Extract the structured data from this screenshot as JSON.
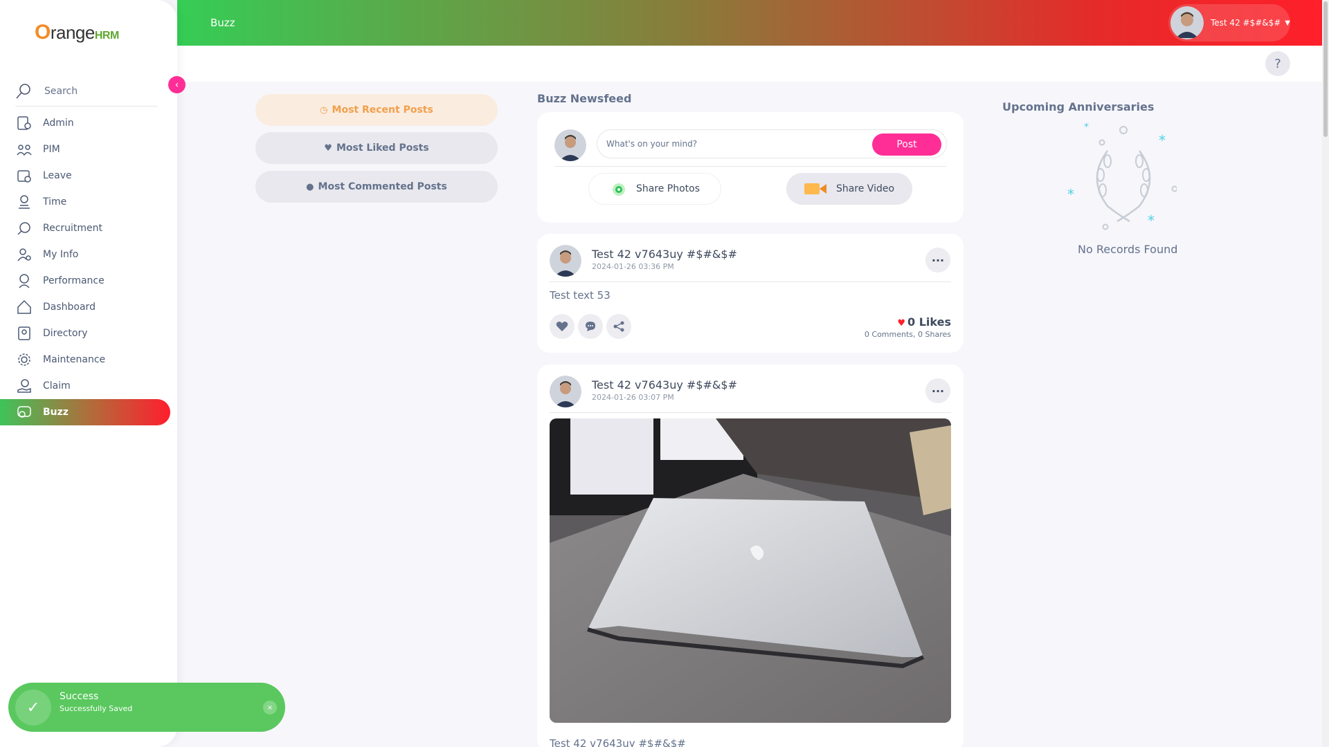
{
  "brand": {
    "part1": "O",
    "part2": "range",
    "part3": "HRM"
  },
  "topbar": {
    "title": "Buzz",
    "user_name": "Test 42 #$#&$#",
    "help": "?"
  },
  "sidebar": {
    "search_label": "Search",
    "collapse_icon": "‹",
    "items": [
      {
        "label": "Admin",
        "icon": "admin-icon"
      },
      {
        "label": "PIM",
        "icon": "pim-icon"
      },
      {
        "label": "Leave",
        "icon": "leave-icon"
      },
      {
        "label": "Time",
        "icon": "time-icon"
      },
      {
        "label": "Recruitment",
        "icon": "recruitment-icon"
      },
      {
        "label": "My Info",
        "icon": "my-info-icon"
      },
      {
        "label": "Performance",
        "icon": "performance-icon"
      },
      {
        "label": "Dashboard",
        "icon": "dashboard-icon"
      },
      {
        "label": "Directory",
        "icon": "directory-icon"
      },
      {
        "label": "Maintenance",
        "icon": "maintenance-icon"
      },
      {
        "label": "Claim",
        "icon": "claim-icon"
      },
      {
        "label": "Buzz",
        "icon": "buzz-icon",
        "active": true
      }
    ]
  },
  "filters": {
    "recent": "Most Recent Posts",
    "liked": "Most Liked Posts",
    "commented": "Most Commented Posts"
  },
  "newsfeed": {
    "title": "Buzz Newsfeed",
    "composer_placeholder": "What's on your mind?",
    "post_button": "Post",
    "share_photos": "Share Photos",
    "share_video": "Share Video"
  },
  "posts": [
    {
      "author": "Test 42 v7643uy #$#&$#",
      "date": "2024-01-26 03:36 PM",
      "text": "Test text 53",
      "likes": "0 Likes",
      "comments": "0 Comments",
      "shares": "0 Shares"
    },
    {
      "author": "Test 42 v7643uy #$#&$#",
      "date": "2024-01-26 03:07 PM",
      "footer_text": "Test 42 v7643uy #$#&$#"
    }
  ],
  "anniversaries": {
    "title": "Upcoming Anniversaries",
    "empty": "No Records Found"
  },
  "toast": {
    "title": "Success",
    "message": "Successfully Saved",
    "close": "×"
  },
  "colors": {
    "accent_pink": "#ff2e97",
    "orange": "#f0a04b",
    "success": "#5ac85e"
  }
}
